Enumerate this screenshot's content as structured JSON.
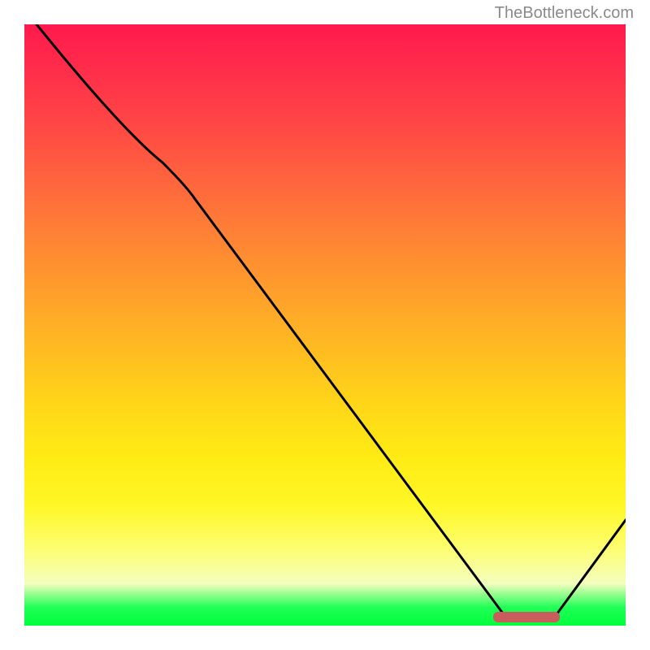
{
  "watermark": "TheBottleneck.com",
  "chart_data": {
    "type": "line",
    "title": "",
    "xlabel": "",
    "ylabel": "",
    "xlim": [
      0,
      100
    ],
    "ylim": [
      0,
      100
    ],
    "curve_points": [
      {
        "x": 2,
        "y": 100
      },
      {
        "x": 23,
        "y": 78
      },
      {
        "x": 28,
        "y": 71
      },
      {
        "x": 80,
        "y": 1
      },
      {
        "x": 88,
        "y": 1
      },
      {
        "x": 100,
        "y": 18
      }
    ],
    "marker": {
      "x_start": 78,
      "x_end": 89,
      "y": 1.5,
      "color": "#c95c5c"
    },
    "gradient_stops": [
      {
        "pos": 0,
        "color": "#ff1a4d"
      },
      {
        "pos": 50,
        "color": "#ffb020"
      },
      {
        "pos": 85,
        "color": "#fff726"
      },
      {
        "pos": 100,
        "color": "#00ff3c"
      }
    ]
  }
}
